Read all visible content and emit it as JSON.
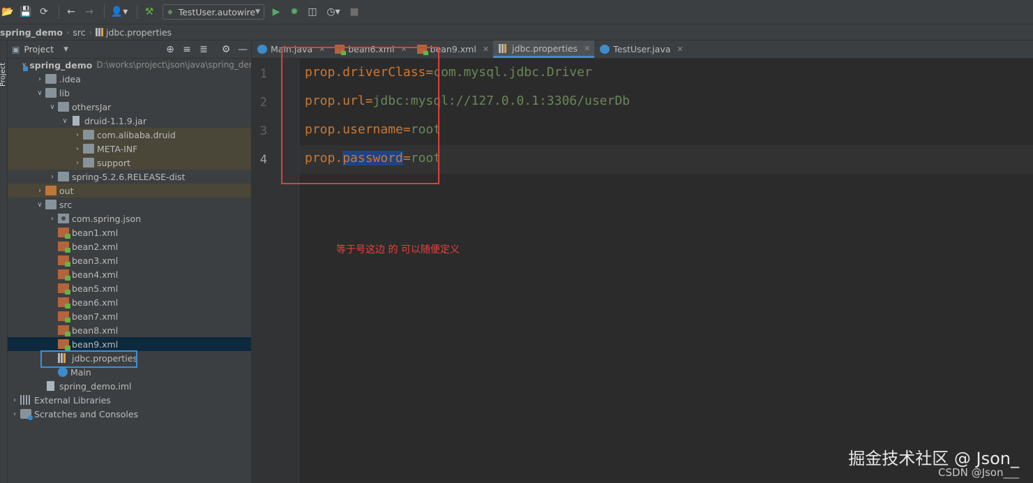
{
  "toolbar": {
    "run_config": "TestUser.autowire"
  },
  "breadcrumbs": [
    "spring_demo",
    "src",
    "jdbc.properties"
  ],
  "side_stripe": "Project",
  "project_panel": {
    "title": "Project"
  },
  "tree": [
    {
      "label": "spring_demo",
      "path": "D:\\works\\project\\json\\java\\spring_der",
      "icon": "module-folder-icon",
      "expanded": true
    },
    {
      "label": ".idea",
      "icon": "folder-icon",
      "expanded": false
    },
    {
      "label": "lib",
      "icon": "folder-icon",
      "expanded": true
    },
    {
      "label": "othersJar",
      "icon": "folder-icon",
      "expanded": true
    },
    {
      "label": "druid-1.1.9.jar",
      "icon": "jar-icon",
      "expanded": true
    },
    {
      "label": "com.alibaba.druid",
      "icon": "folder-icon",
      "expanded": false
    },
    {
      "label": "META-INF",
      "icon": "folder-icon",
      "expanded": false
    },
    {
      "label": "support",
      "icon": "folder-icon",
      "expanded": false
    },
    {
      "label": "spring-5.2.6.RELEASE-dist",
      "icon": "folder-icon",
      "expanded": false
    },
    {
      "label": "out",
      "icon": "excluded-folder-icon",
      "expanded": false
    },
    {
      "label": "src",
      "icon": "source-folder-icon",
      "expanded": true
    },
    {
      "label": "com.spring.json",
      "icon": "package-icon",
      "expanded": false
    },
    {
      "label": "bean1.xml",
      "icon": "xml-file-icon"
    },
    {
      "label": "bean2.xml",
      "icon": "xml-file-icon"
    },
    {
      "label": "bean3.xml",
      "icon": "xml-file-icon"
    },
    {
      "label": "bean4.xml",
      "icon": "xml-file-icon"
    },
    {
      "label": "bean5.xml",
      "icon": "xml-file-icon"
    },
    {
      "label": "bean6.xml",
      "icon": "xml-file-icon"
    },
    {
      "label": "bean7.xml",
      "icon": "xml-file-icon"
    },
    {
      "label": "bean8.xml",
      "icon": "xml-file-icon"
    },
    {
      "label": "bean9.xml",
      "icon": "xml-file-icon"
    },
    {
      "label": "jdbc.properties",
      "icon": "properties-file-icon"
    },
    {
      "label": "Main",
      "icon": "java-class-icon"
    },
    {
      "label": "spring_demo.iml",
      "icon": "iml-file-icon"
    },
    {
      "label": "External Libraries",
      "icon": "libraries-icon",
      "expanded": false
    },
    {
      "label": "Scratches and Consoles",
      "icon": "scratches-icon",
      "expanded": false
    }
  ],
  "tabs": [
    {
      "label": "Main.java",
      "icon": "java-class-icon"
    },
    {
      "label": "bean6.xml",
      "icon": "xml-file-icon"
    },
    {
      "label": "bean9.xml",
      "icon": "xml-file-icon"
    },
    {
      "label": "jdbc.properties",
      "icon": "properties-file-icon",
      "active": true
    },
    {
      "label": "TestUser.java",
      "icon": "java-class-icon"
    }
  ],
  "editor": {
    "line_numbers": [
      "1",
      "2",
      "3",
      "4"
    ],
    "lines": [
      {
        "key": "prop.driverClass",
        "eq": "=",
        "value": "com.mysql.jdbc.Driver"
      },
      {
        "key": "prop.url",
        "eq": "=",
        "value": "jdbc:mysql://127.0.0.1:3306/userDb"
      },
      {
        "key": "prop.username",
        "eq": "=",
        "value": "root"
      },
      {
        "key_prefix": "prop.",
        "key_selected": "password",
        "eq": "=",
        "value": "root"
      }
    ],
    "annotation": "等于号这边 的 可以随便定义"
  },
  "watermark": {
    "main": "掘金技术社区 @ Json_",
    "sub": "CSDN @Json___"
  },
  "colors": {
    "keyword": "#cc7832",
    "string_value": "#6a8759",
    "selection": "#214283",
    "annotation_red": "#e8413c",
    "highlight_box_blue": "#3d8fd8"
  }
}
